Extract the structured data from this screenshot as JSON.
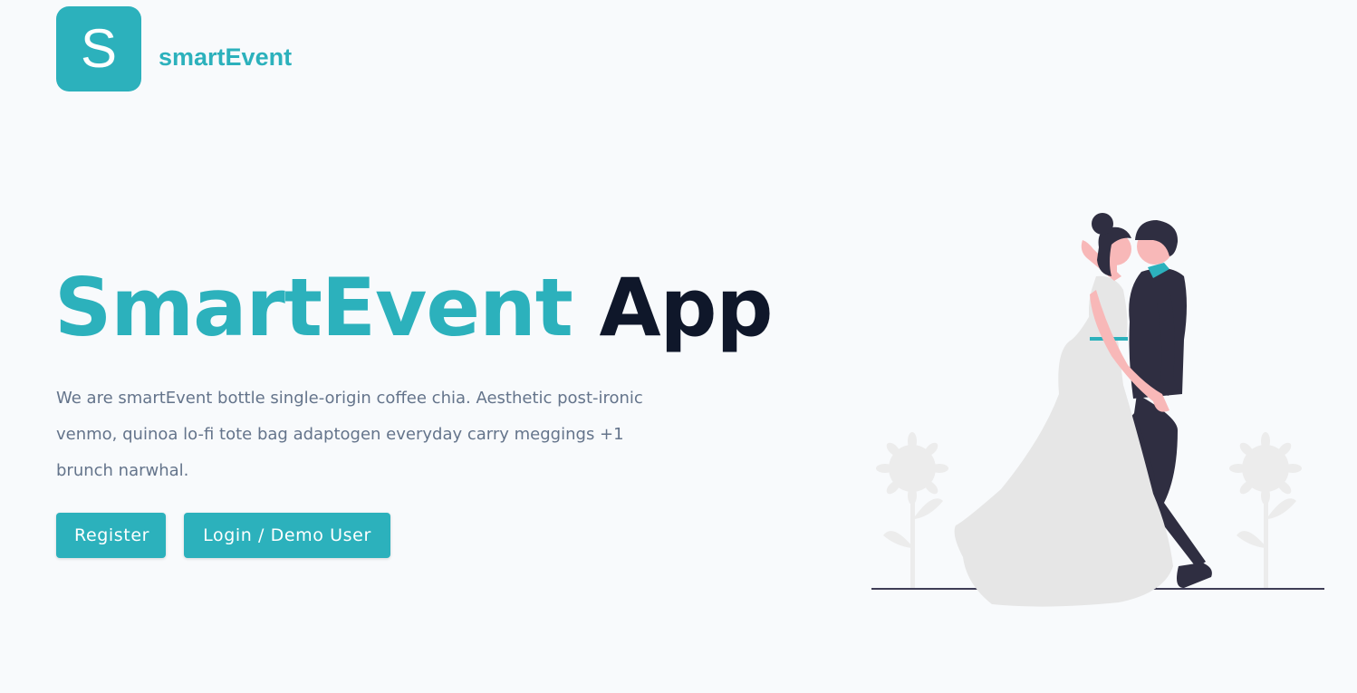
{
  "logo": {
    "letter": "S",
    "brand_name": "smartEvent"
  },
  "hero": {
    "title_accent": "SmartEvent",
    "title_rest": "App",
    "description": "We are smartEvent bottle single-origin coffee chia. Aesthetic post-ironic venmo, quinoa lo-fi tote bag adaptogen everyday carry meggings +1 brunch narwhal.",
    "register_label": "Register",
    "login_label": "Login / Demo User"
  },
  "colors": {
    "primary": "#2cb1bc",
    "heading_dark": "#0f172a",
    "text_muted": "#64748b",
    "background": "#f8fafc"
  },
  "illustration": {
    "icon": "wedding-couple-illustration"
  }
}
